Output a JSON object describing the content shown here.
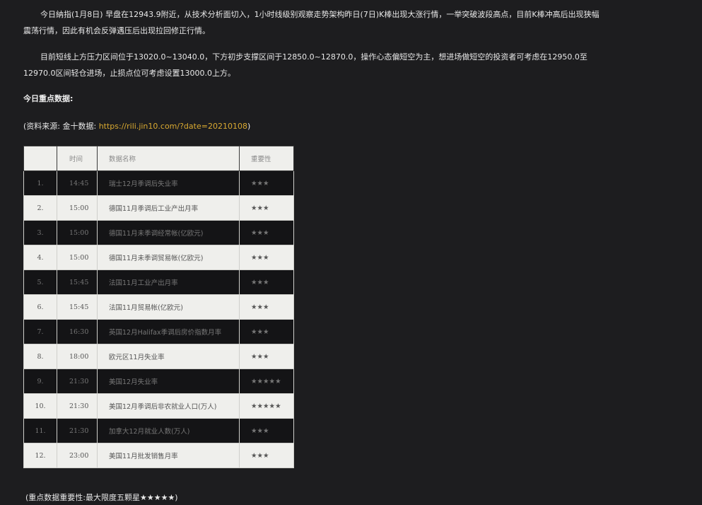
{
  "article": {
    "para1": "今日納指(1月8日) 早盘在12943.9附近，从技术分析面切入，1小时线级别观察走势架构昨日(7日)K棒出现大涨行情，一举突破波段高点，目前K棒冲高后出现狭幅震荡行情，因此有机会反弹遇压后出现拉回修正行情。",
    "para2": "目前短线上方压力区间位于13020.0~13040.0，下方初步支撑区间于12850.0~12870.0，操作心态偏短空为主，想进场做短空的投资者可考虑在12950.0至12970.0区间轻仓进场，止损点位可考虑设置13000.0上方。",
    "heading": "今日重点数据:",
    "source_prefix": "(资料来源: 金十数据: ",
    "source_link": "https://rili.jin10.com/?date=20210108",
    "source_suffix": ")",
    "footer": "(重点数据重要性:最大限度五颗星★★★★★)"
  },
  "table": {
    "headers": [
      "",
      "时间",
      "数据名称",
      "重要性"
    ],
    "rows": [
      {
        "no": "1.",
        "time": "14:45",
        "name": "瑞士12月季调后失业率",
        "stars": "★★★"
      },
      {
        "no": "2.",
        "time": "15:00",
        "name": "德国11月季调后工业产出月率",
        "stars": "★★★"
      },
      {
        "no": "3.",
        "time": "15:00",
        "name": "德国11月未季调经常帐(亿欧元)",
        "stars": "★★★"
      },
      {
        "no": "4.",
        "time": "15:00",
        "name": "德国11月未季调贸易帐(亿欧元)",
        "stars": "★★★"
      },
      {
        "no": "5.",
        "time": "15:45",
        "name": "法国11月工业产出月率",
        "stars": "★★★"
      },
      {
        "no": "6.",
        "time": "15:45",
        "name": "法国11月贸易帐(亿欧元)",
        "stars": "★★★"
      },
      {
        "no": "7.",
        "time": "16:30",
        "name": "英国12月Halifax季调后房价指数月率",
        "stars": "★★★"
      },
      {
        "no": "8.",
        "time": "18:00",
        "name": "欧元区11月失业率",
        "stars": "★★★"
      },
      {
        "no": "9.",
        "time": "21:30",
        "name": "美国12月失业率",
        "stars": "★★★★★"
      },
      {
        "no": "10.",
        "time": "21:30",
        "name": "美国12月季调后非农就业人口(万人)",
        "stars": "★★★★★"
      },
      {
        "no": "11.",
        "time": "21:30",
        "name": "加拿大12月就业人数(万人)",
        "stars": "★★★"
      },
      {
        "no": "12.",
        "time": "23:00",
        "name": "美国11月批发销售月率",
        "stars": "★★★"
      }
    ]
  }
}
